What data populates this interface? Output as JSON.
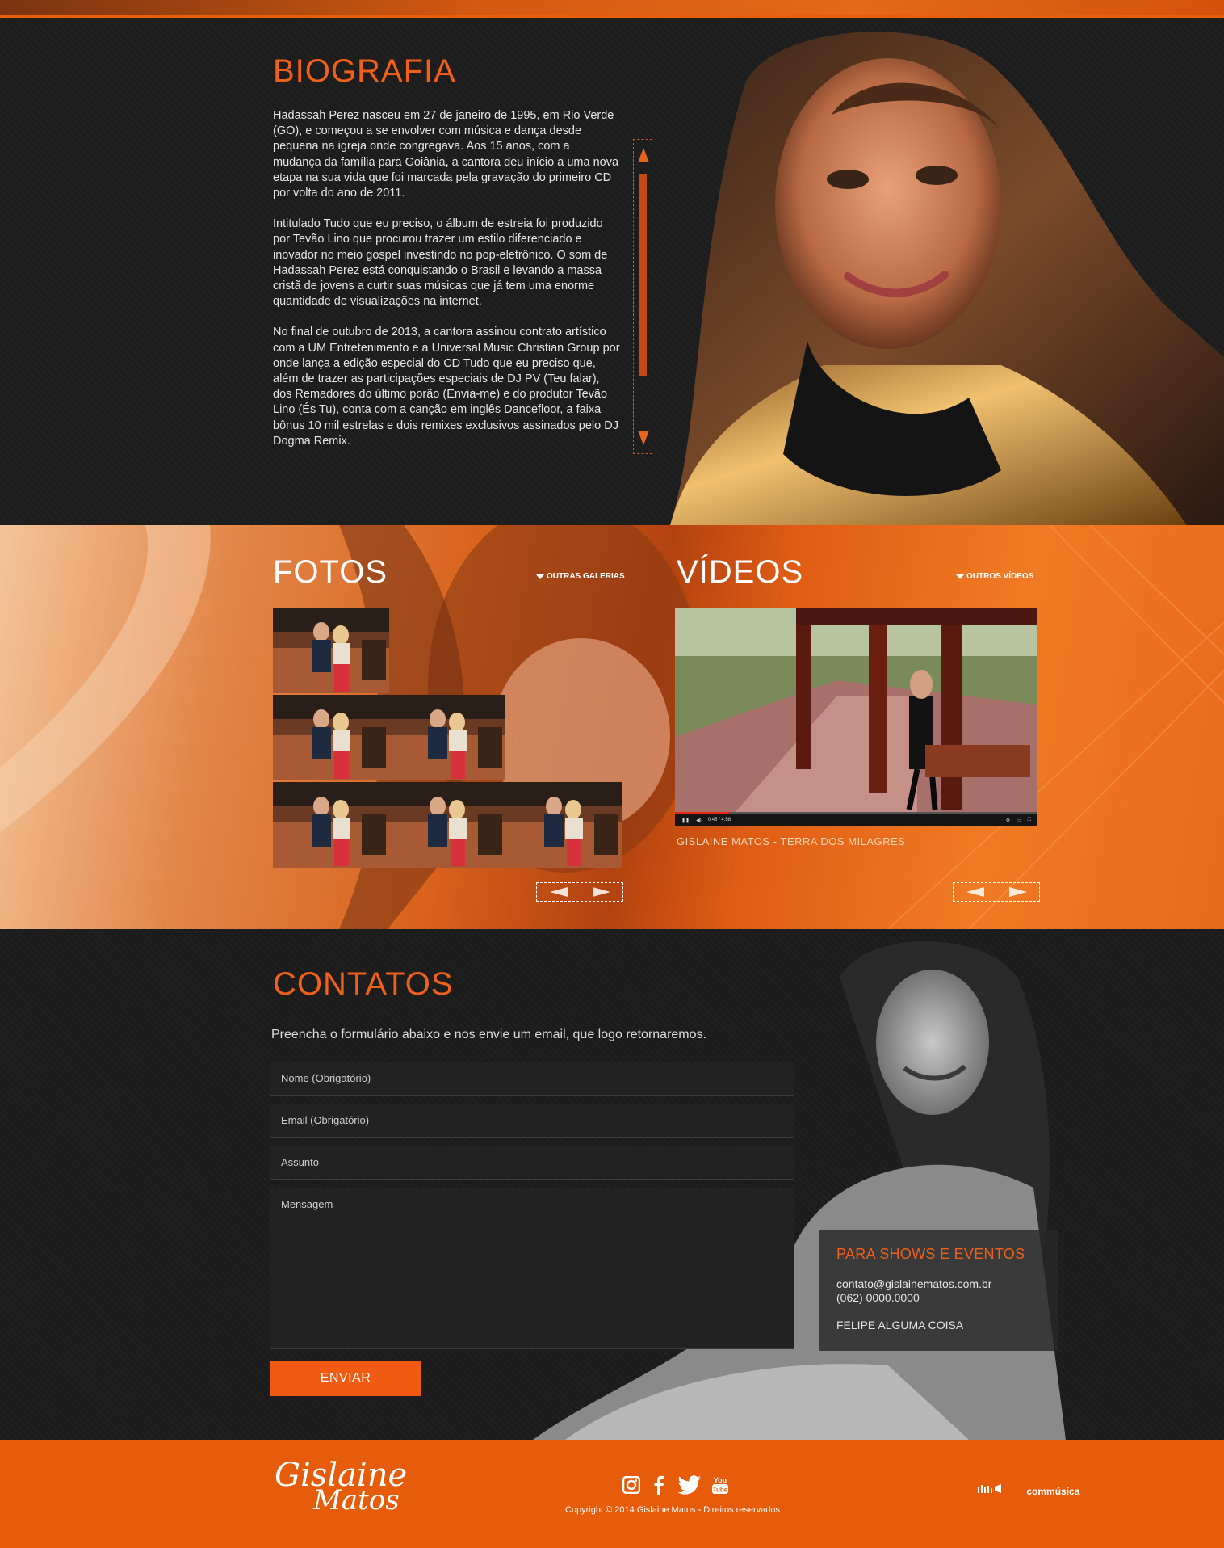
{
  "bio": {
    "title": "BIOGRAFIA",
    "paragraphs": [
      "Hadassah Perez nasceu em 27 de janeiro de 1995, em Rio Verde (GO), e começou a se envolver com música e dança desde pequena na igreja onde congregava. Aos 15 anos, com a mudança da família para Goiânia, a cantora deu início a uma nova etapa na sua vida que foi marcada pela gravação do primeiro CD por volta do ano de 2011.",
      "Intitulado Tudo que eu preciso, o álbum de estreia foi produzido por Tevão Lino que procurou trazer um estilo diferenciado e inovador no meio gospel investindo no pop-eletrônico. O som de Hadassah Perez está conquistando o Brasil e levando a massa cristã de jovens a curtir suas músicas que já tem uma enorme quantidade de visualizações na internet.",
      "No final de outubro de 2013, a cantora assinou contrato artístico com a UM Entretenimento e a Universal Music Christian Group por onde lança a edição especial do CD Tudo que eu preciso que, além de trazer as participações especiais de DJ PV (Teu falar), dos Remadores do último porão (Envia-me) e do produtor Tevão Lino (És Tu), conta com a canção em inglês Dancefloor, a faixa bônus 10 mil estrelas e dois remixes exclusivos assinados pelo DJ Dogma Remix."
    ]
  },
  "photos": {
    "title": "FOTOS",
    "more_label": "OUTRAS GALERIAS"
  },
  "videos": {
    "title": "VÍDEOS",
    "more_label": "OUTROS VÍDEOS",
    "caption": "GISLAINE MATOS - TERRA DOS MILAGRES",
    "time": "0:45 / 4:58"
  },
  "contacts": {
    "title": "CONTATOS",
    "subtitle": "Preencha o formulário abaixo e nos envie um email, que logo retornaremos.",
    "fields": {
      "name": "Nome (Obrigatório)",
      "email": "Email (Obrigatório)",
      "subject": "Assunto",
      "message": "Mensagem"
    },
    "submit_label": "ENVIAR",
    "shows": {
      "title": "PARA SHOWS E EVENTOS",
      "email": "contato@gislainematos.com.br",
      "phone": "(062) 0000.0000",
      "name": "FELIPE ALGUMA COISA"
    }
  },
  "footer": {
    "logo_line1": "Gislaine",
    "logo_line2": "Matos",
    "copyright": "Copyright © 2014 Gislaine Matos - Direitos reservados",
    "partner": "commúsica",
    "social_icons": [
      "instagram-icon",
      "facebook-icon",
      "twitter-icon",
      "youtube-icon"
    ]
  },
  "colors": {
    "accent": "#f06018",
    "footer": "#e65c0a",
    "dark_bg": "#1d1d1d"
  }
}
